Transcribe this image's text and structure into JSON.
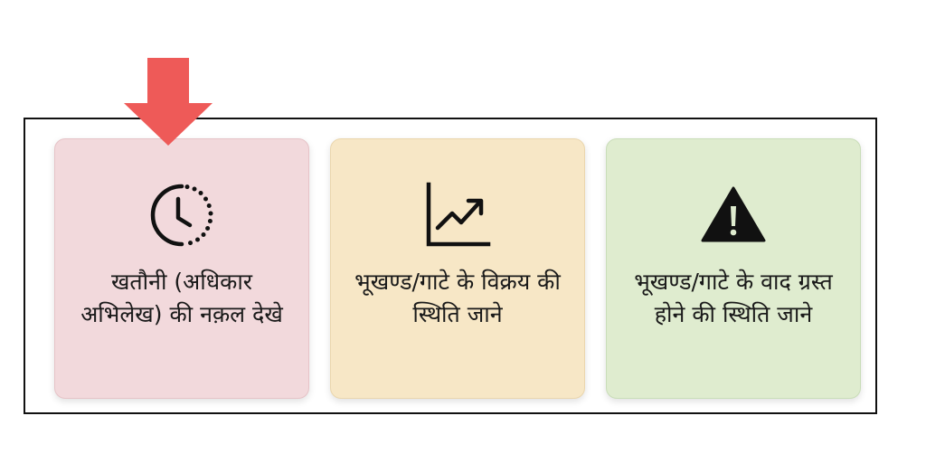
{
  "cards": [
    {
      "label": "खतौनी (अधिकार अभिलेख) की नक़ल देखे",
      "icon": "clock-history-icon",
      "background": "#f2d9dc"
    },
    {
      "label": "भूखण्ड/गाटे के विक्रय की स्थिति जाने",
      "icon": "trending-up-chart-icon",
      "background": "#f7e7c6"
    },
    {
      "label": "भूखण्ड/गाटे के वाद ग्रस्त होने की स्थिति जाने",
      "icon": "warning-triangle-icon",
      "background": "#dfeccf"
    }
  ],
  "pointer": {
    "icon": "down-arrow-indicator-icon",
    "color": "#ee5a58"
  }
}
